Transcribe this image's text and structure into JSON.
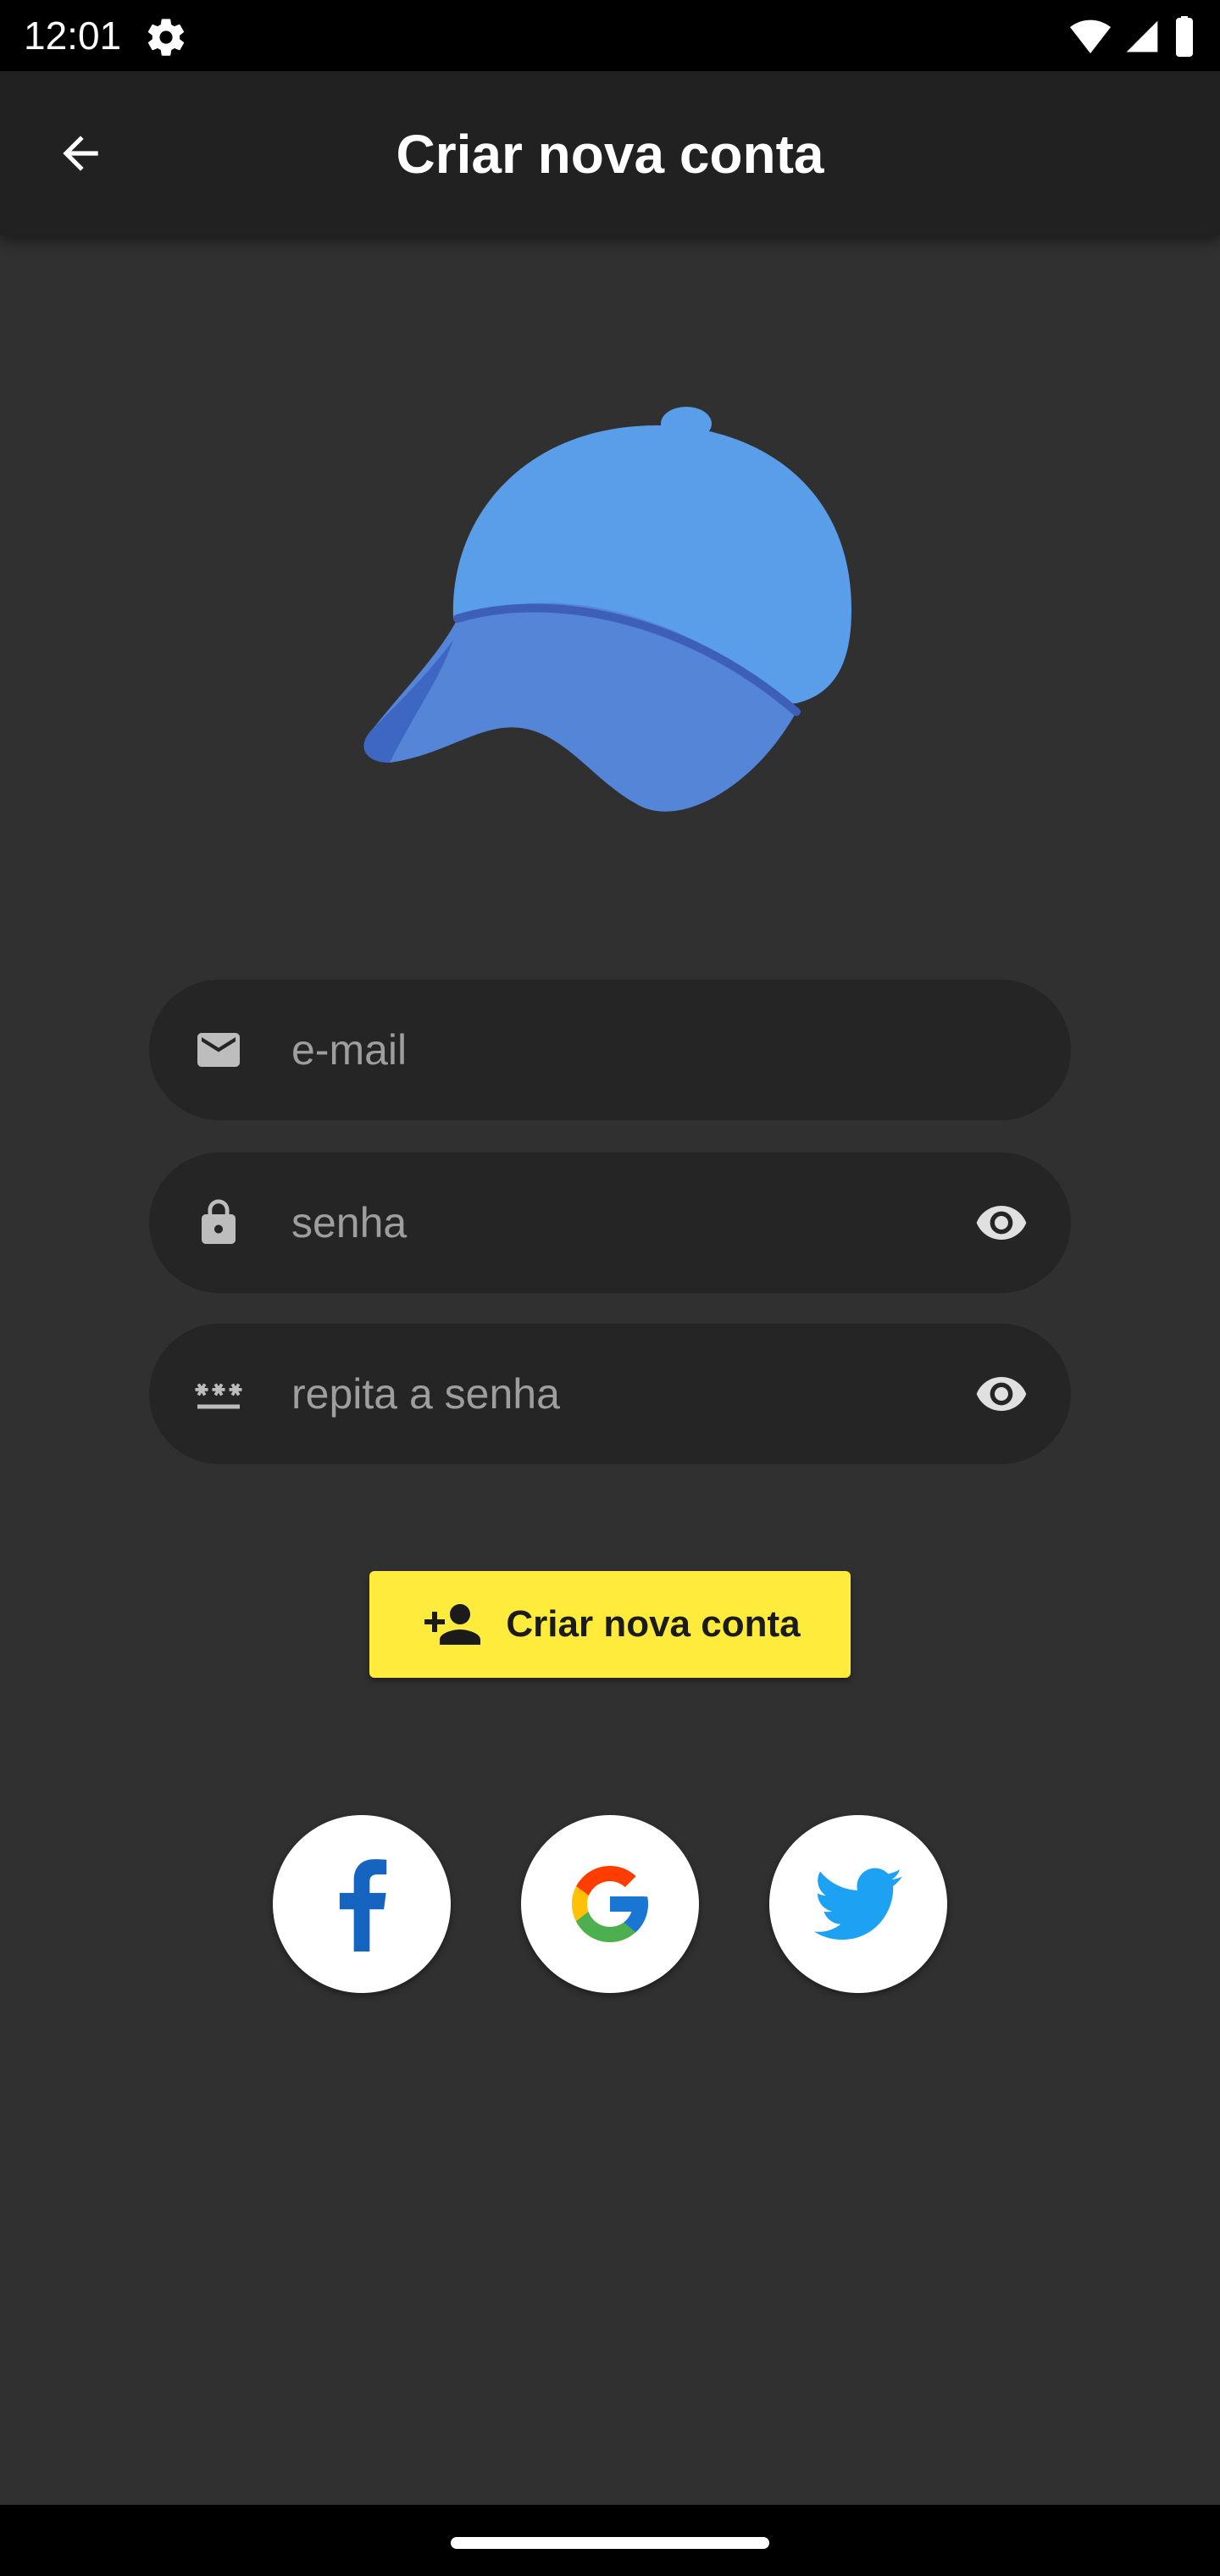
{
  "status_bar": {
    "time": "12:01",
    "icons": [
      "settings-gear-icon",
      "wifi-icon",
      "signal-icon",
      "battery-icon"
    ]
  },
  "app_bar": {
    "title": "Criar nova conta",
    "back_icon": "arrow-back-icon"
  },
  "hero": {
    "icon": "cap-illustration"
  },
  "form": {
    "email": {
      "placeholder": "e-mail",
      "value": "",
      "icon": "mail-icon"
    },
    "password": {
      "placeholder": "senha",
      "value": "",
      "icon": "lock-icon",
      "toggle_icon": "eye-icon"
    },
    "repeat_password": {
      "placeholder": "repita a senha",
      "value": "",
      "icon": "password-dots-icon",
      "toggle_icon": "eye-icon"
    }
  },
  "create_button": {
    "label": "Criar nova conta",
    "icon": "person-add-icon",
    "color": "#ffeb3b"
  },
  "social": [
    {
      "name": "facebook",
      "icon": "facebook-icon",
      "color": "#1565c0"
    },
    {
      "name": "google",
      "icon": "google-icon"
    },
    {
      "name": "twitter",
      "icon": "twitter-icon",
      "color": "#1da1f2"
    }
  ],
  "colors": {
    "background": "#303030",
    "app_bar": "#212121",
    "field": "#252525",
    "cap": "#5a9de8"
  }
}
